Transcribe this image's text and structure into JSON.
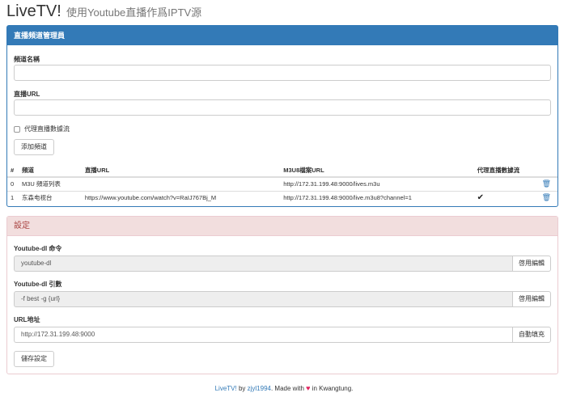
{
  "header": {
    "title": "LiveTV!",
    "subtitle": "使用Youtube直播作爲IPTV源"
  },
  "channel_panel": {
    "heading": "直播頻道管理員",
    "name_label": "頻道名稱",
    "name_value": "",
    "url_label": "直播URL",
    "url_value": "",
    "proxy_label": "代理直播數據流",
    "proxy_checked": false,
    "add_button": "添加頻道",
    "table": {
      "columns": [
        "#",
        "頻道",
        "直播URL",
        "M3U8檔案URL",
        "代理直播數據流"
      ],
      "rows": [
        {
          "index": "0",
          "channel": "M3U 頻道列表",
          "live_url": "",
          "m3u8_url": "http://172.31.199.48:9000/lives.m3u",
          "proxy": ""
        },
        {
          "index": "1",
          "channel": "东森电视台",
          "live_url": "https://www.youtube.com/watch?v=RaIJ767Bj_M",
          "m3u8_url": "http://172.31.199.48:9000/live.m3u8?channel=1",
          "proxy": "✔"
        }
      ],
      "delete_icon": "trash-icon",
      "delete_glyph": "🗑"
    }
  },
  "settings_panel": {
    "heading": "設定",
    "ytdl_cmd_label": "Youtube-dl 命令",
    "ytdl_cmd_value": "youtube-dl",
    "ytdl_cmd_button": "啓用編輯",
    "ytdl_args_label": "Youtube-dl 引數",
    "ytdl_args_value": "-f best -g {url}",
    "ytdl_args_button": "啓用編輯",
    "url_label": "URL地址",
    "url_value": "http://172.31.199.48:9000",
    "url_button": "自動填充",
    "save_button": "儲存設定"
  },
  "footer": {
    "brand": "LiveTV!",
    "by": " by ",
    "author": "zjyl1994",
    "made_with": ". Made with ",
    "heart": "♥",
    "in_place": " in Kwangtung."
  },
  "colors": {
    "primary": "#337ab7",
    "danger_bg": "#f2dede",
    "danger_text": "#a94442",
    "heart": "#e0245e"
  }
}
